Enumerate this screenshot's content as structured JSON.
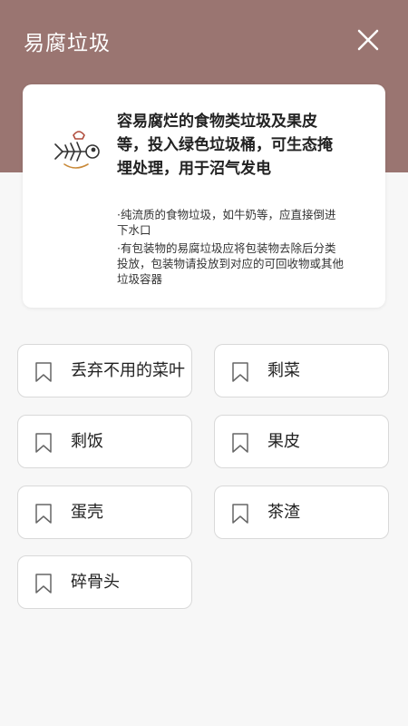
{
  "header": {
    "title": "易腐垃圾",
    "close_icon": "close-icon",
    "bg_color": "#9a7571"
  },
  "card": {
    "icon": "fish-bone-icon",
    "description": "容易腐烂的食物类垃圾及果皮等，投入绿色垃圾桶，可生态掩埋处理，用于沼气发电",
    "notes": [
      "·纯流质的食物垃圾，如牛奶等，应直接倒进下水口",
      "·有包装物的易腐垃圾应将包装物去除后分类投放，包装物请投放到对应的可回收物或其他垃圾容器"
    ]
  },
  "items": [
    {
      "label": "丢弃不用的菜叶",
      "icon": "bookmark-icon"
    },
    {
      "label": "剩菜",
      "icon": "bookmark-icon"
    },
    {
      "label": "剩饭",
      "icon": "bookmark-icon"
    },
    {
      "label": "果皮",
      "icon": "bookmark-icon"
    },
    {
      "label": "蛋壳",
      "icon": "bookmark-icon"
    },
    {
      "label": "茶渣",
      "icon": "bookmark-icon"
    },
    {
      "label": "碎骨头",
      "icon": "bookmark-icon"
    }
  ]
}
